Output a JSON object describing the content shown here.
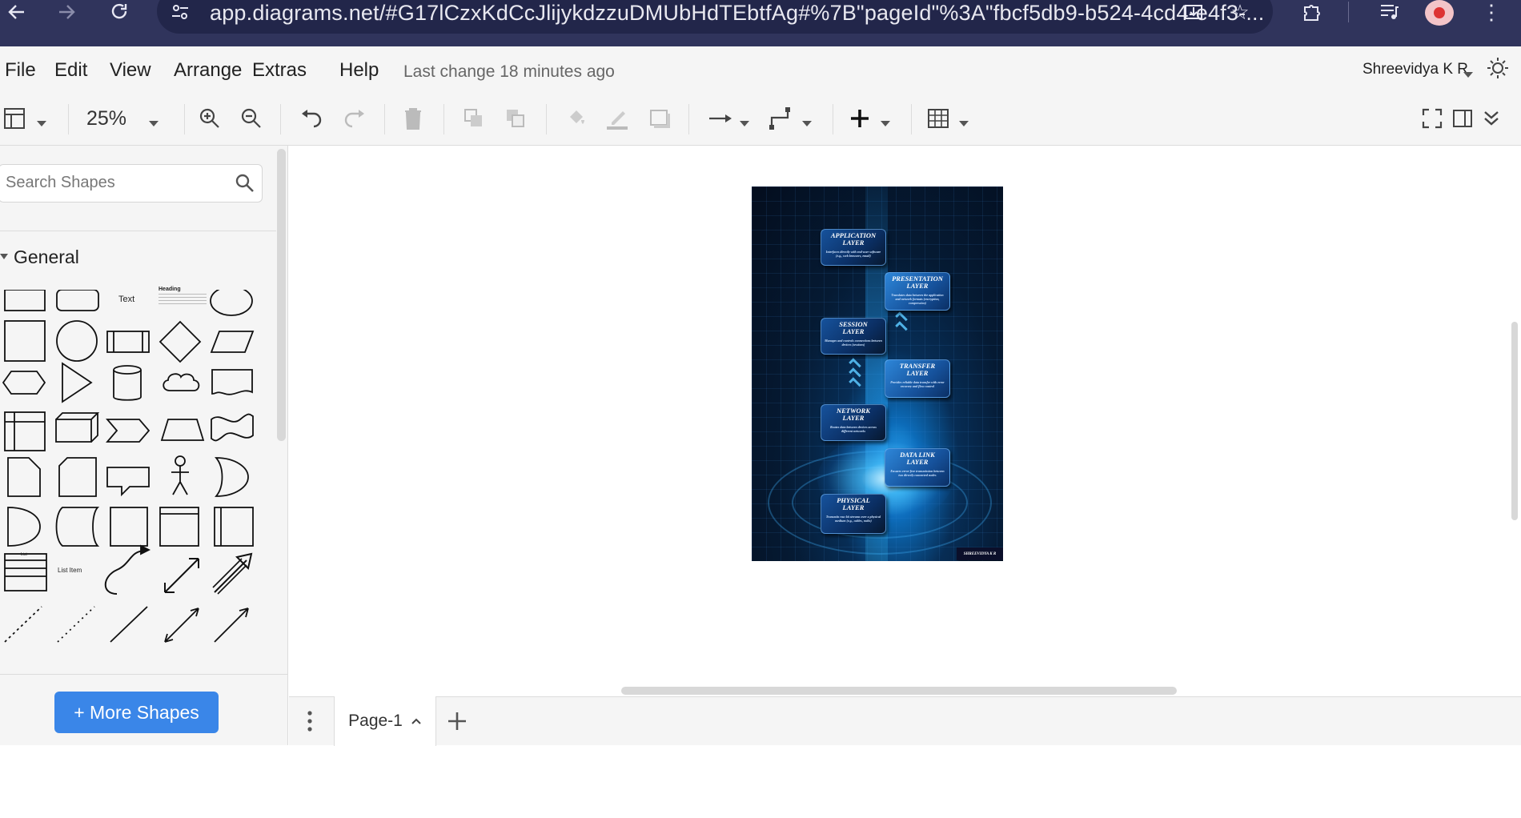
{
  "browser": {
    "url": "app.diagrams.net/#G17lCzxKdCcJlijykdzzuDMUbHdTEbtfAg#%7B\"pageId\"%3A\"fbcf5db9-b524-4cd4-e4f3-..."
  },
  "menubar": {
    "items": [
      "File",
      "Edit",
      "View",
      "Arrange",
      "Extras",
      "Help"
    ],
    "last_change": "Last change 18 minutes ago",
    "user": "Shreevidya K R"
  },
  "toolbar": {
    "zoom": "25%"
  },
  "sidebar": {
    "search_placeholder": "Search Shapes",
    "section_title": "General",
    "shape_text_label": "Text",
    "shape_heading_label": "Heading",
    "shape_list_label": "List",
    "shape_list_item_label": "List Item",
    "more_shapes_label": "+ More Shapes"
  },
  "diagram": {
    "layers": [
      {
        "title": "APPLICATION\nLAYER",
        "desc": "Interfaces directly with end-user software (e.g., web browsers, email)"
      },
      {
        "title": "PRESENTATION\nLAYER",
        "desc": "Translates data between the application and network formats (encryption, compression)"
      },
      {
        "title": "SESSION\nLAYER",
        "desc": "Manages and controls connections between devices (sessions)"
      },
      {
        "title": "TRANSFER\nLAYER",
        "desc": "Provides reliable data transfer with error recovery and flow control"
      },
      {
        "title": "NETWORK\nLAYER",
        "desc": "Routes data between devices across different networks"
      },
      {
        "title": "DATA LINK\nLAYER",
        "desc": "Ensures error-free transmission between two directly connected nodes"
      },
      {
        "title": "PHYSICAL\nLAYER",
        "desc": "Transmits raw bit streams over a physical medium (e.g., cables, radio)"
      }
    ],
    "credit": "SHREEVIDYA K R"
  },
  "footer": {
    "page_tab": "Page-1"
  }
}
